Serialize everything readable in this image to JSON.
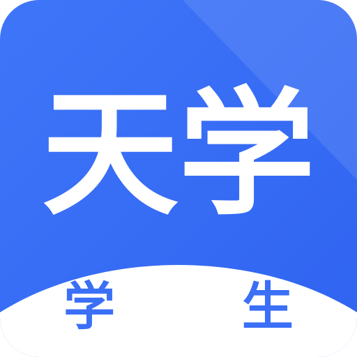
{
  "icon": {
    "title": "天学",
    "subtitle": "学 生"
  },
  "colors": {
    "background_start": "#3f76f8",
    "background_end": "#2f63f1",
    "sheen": "#ffffff",
    "title_text": "#ffffff",
    "subtitle_text": "#3a6ff6",
    "wave_fill": "#ffffff"
  }
}
